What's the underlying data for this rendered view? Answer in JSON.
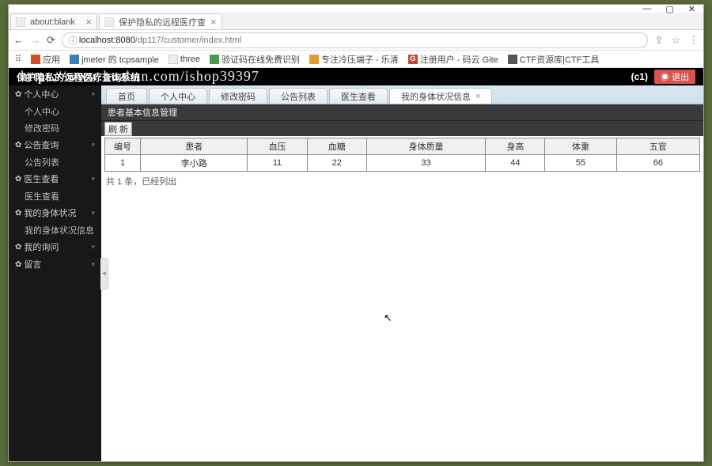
{
  "browser": {
    "tabs": [
      {
        "title": "about:blank",
        "active": false
      },
      {
        "title": "保护隐私的远程医疗查",
        "active": true
      }
    ],
    "url_host": "localhost:8080",
    "url_path": "/dp117/customer/index.html",
    "bookmarks": [
      {
        "label": "应用",
        "color": "#d04a2b"
      },
      {
        "label": "jmeter 的 tcpsample",
        "color": "#3b7fb5"
      },
      {
        "label": "three",
        "color": "#888"
      },
      {
        "label": "验证码在线免费识别",
        "color": "#4b9a4b"
      },
      {
        "label": "专注冷压端子 - 乐清",
        "color": "#e29b2f"
      },
      {
        "label": "注册用户 - 码云 Gite",
        "color": "#c8453a"
      },
      {
        "label": "CTF资源库|CTF工具",
        "color": "#555"
      }
    ]
  },
  "app": {
    "title": "保护隐私的远程医疗查询系统",
    "watermark": "https://www.huzhan.com/ishop39397",
    "user_badge": "(c1)",
    "logout": "退出"
  },
  "sidebar": [
    {
      "cat": "个人中心",
      "items": [
        "个人中心",
        "修改密码"
      ]
    },
    {
      "cat": "公告查询",
      "items": [
        "公告列表"
      ]
    },
    {
      "cat": "医生查看",
      "items": [
        "医生查看"
      ]
    },
    {
      "cat": "我的身体状况",
      "items": [
        "我的身体状况信息"
      ]
    },
    {
      "cat": "我的询问",
      "items": []
    },
    {
      "cat": "留言",
      "items": []
    }
  ],
  "content_tabs": [
    {
      "label": "首页"
    },
    {
      "label": "个人中心"
    },
    {
      "label": "修改密码"
    },
    {
      "label": "公告列表"
    },
    {
      "label": "医生查看"
    },
    {
      "label": "我的身体状况信息",
      "active": true,
      "closable": true
    }
  ],
  "panel": {
    "title": "患者基本信息管理",
    "refresh": "刷 新",
    "columns": [
      "编号",
      "患者",
      "血压",
      "血糖",
      "身体质量",
      "身高",
      "体重",
      "五官"
    ],
    "rows": [
      [
        "1",
        "李小路",
        "11",
        "22",
        "33",
        "44",
        "55",
        "66"
      ]
    ],
    "footer": "共 1 条，已经列出"
  }
}
